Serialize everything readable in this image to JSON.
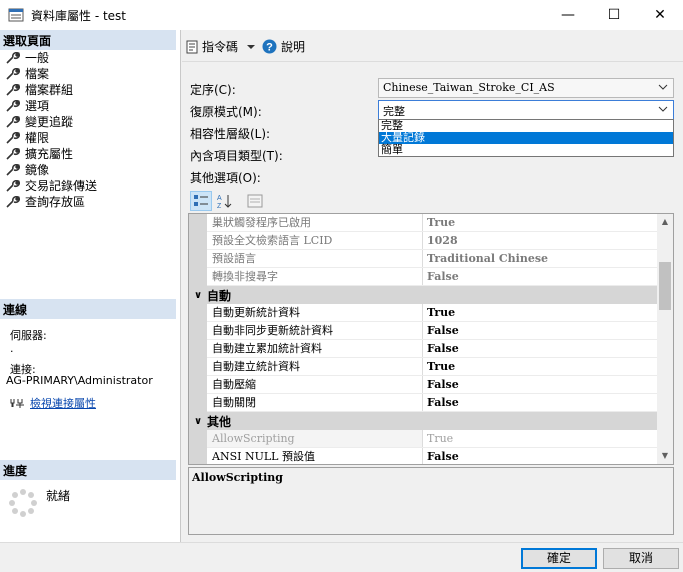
{
  "window": {
    "title": "資料庫屬性 - test",
    "controls": {
      "minimize": "—",
      "maximize": "☐",
      "close": "✕"
    }
  },
  "left_panel": {
    "select_page_header": "選取頁面",
    "pages": [
      "一般",
      "檔案",
      "檔案群組",
      "選項",
      "變更追蹤",
      "權限",
      "擴充屬性",
      "鏡像",
      "交易記錄傳送",
      "查詢存放區"
    ],
    "connection_header": "連線",
    "server_label": "伺服器:",
    "server_value": ".",
    "connection_label": "連接:",
    "connection_value": "AG-PRIMARY\\Administrator",
    "view_connection_link": "檢視連接屬性",
    "progress_header": "進度",
    "progress_status": "就緒"
  },
  "toolbar": {
    "script_label": "指令碼",
    "help_label": "說明"
  },
  "options": {
    "collation_label": "定序(C):",
    "collation_value": "Chinese_Taiwan_Stroke_CI_AS",
    "recovery_label": "復原模式(M):",
    "recovery_value": "完整",
    "recovery_options": [
      "完整",
      "大量記錄",
      "簡單"
    ],
    "recovery_selected_index": 1,
    "compat_label": "相容性層級(L):",
    "containment_label": "內含項目類型(T):",
    "other_options_label": "其他選項(O):"
  },
  "grid": {
    "rows": [
      {
        "type": "prop",
        "name": "巢狀觸發程序已啟用",
        "value": "True",
        "style": "ro"
      },
      {
        "type": "prop",
        "name": "預設全文檢索語言 LCID",
        "value": "1028",
        "style": "ro"
      },
      {
        "type": "prop",
        "name": "預設語言",
        "value": "Traditional Chinese",
        "style": "ro"
      },
      {
        "type": "prop",
        "name": "轉換非搜尋字",
        "value": "False",
        "style": "ro"
      },
      {
        "type": "cat",
        "name": "自動"
      },
      {
        "type": "prop",
        "name": "自動更新統計資料",
        "value": "True",
        "style": ""
      },
      {
        "type": "prop",
        "name": "自動非同步更新統計資料",
        "value": "False",
        "style": ""
      },
      {
        "type": "prop",
        "name": "自動建立累加統計資料",
        "value": "False",
        "style": ""
      },
      {
        "type": "prop",
        "name": "自動建立統計資料",
        "value": "True",
        "style": ""
      },
      {
        "type": "prop",
        "name": "自動壓縮",
        "value": "False",
        "style": ""
      },
      {
        "type": "prop",
        "name": "自動關閉",
        "value": "False",
        "style": ""
      },
      {
        "type": "cat",
        "name": "其他"
      },
      {
        "type": "prop",
        "name": "AllowScripting",
        "value": "True",
        "style": "dim"
      },
      {
        "type": "prop",
        "name": "ANSI NULL 預設值",
        "value": "False",
        "style": ""
      }
    ]
  },
  "description": {
    "title": "AllowScripting"
  },
  "buttons": {
    "ok": "確定",
    "cancel": "取消"
  }
}
